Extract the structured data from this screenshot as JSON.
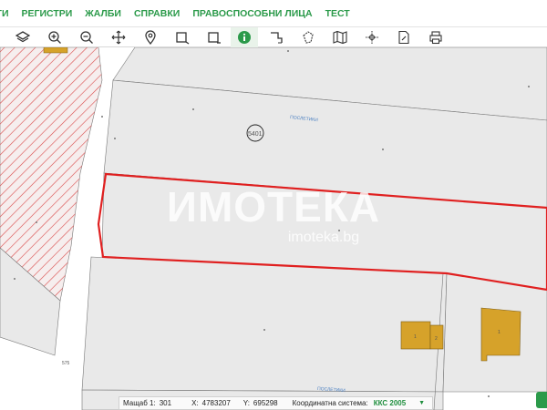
{
  "menu": {
    "items": [
      {
        "id": "m0",
        "label": "ГИ"
      },
      {
        "id": "m1",
        "label": "РЕГИСТРИ"
      },
      {
        "id": "m2",
        "label": "ЖАЛБИ"
      },
      {
        "id": "m3",
        "label": "СПРАВКИ"
      },
      {
        "id": "m4",
        "label": "ПРАВОСПОСОБНИ ЛИЦА"
      },
      {
        "id": "m5",
        "label": "ТЕСТ"
      }
    ]
  },
  "toolbar": {
    "tools": [
      "layers-icon",
      "zoom-in-icon",
      "zoom-out-icon",
      "pan-icon",
      "location-pin-icon",
      "select-rect-icon",
      "select-rect-minus-icon",
      "info-icon",
      "measure-angle-icon",
      "draw-polygon-icon",
      "map-icon",
      "coordinate-grid-icon",
      "document-edit-icon",
      "print-icon"
    ],
    "active": "info-icon",
    "accent": "#2b9a4a"
  },
  "map": {
    "parcel_number": "5401",
    "street_label_1": "ПОСЛЕТИКИ",
    "street_label_2": "ПОСЛЕТИКИ",
    "road_label": "575",
    "building_labels": [
      "1",
      "2",
      "1"
    ],
    "colors": {
      "parcel_fill": "#e9e9e9",
      "selected_outline": "#e02020",
      "hatch": "#d94848",
      "building": "#d6a22a",
      "road": "#ffffff"
    }
  },
  "watermark": {
    "main": "ИМОТЕКА",
    "sub": "imoteka.bg"
  },
  "status": {
    "scale_label": "Мащаб 1:",
    "scale_value": "301",
    "x_label": "X:",
    "x_value": "4783207",
    "y_label": "Y:",
    "y_value": "695298",
    "coord_label": "Координатна система:",
    "coord_value": "ККС 2005"
  }
}
